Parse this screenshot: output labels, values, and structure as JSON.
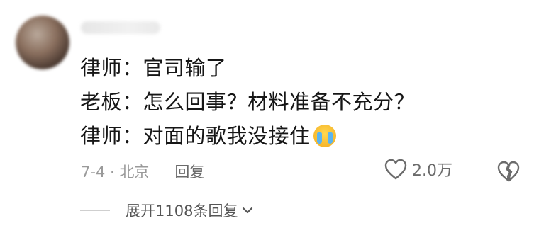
{
  "comment": {
    "lines": [
      "律师：官司输了",
      "老板：怎么回事？材料准备不充分？",
      "律师：对面的歌我没接住"
    ]
  },
  "meta": {
    "date_location": "7-4 · 北京",
    "reply_label": "回复"
  },
  "actions": {
    "like_count": "2.0万"
  },
  "replies": {
    "expand_label": "展开1108条回复"
  },
  "icons": {
    "like": "heart-outline-icon",
    "dislike": "broken-heart-icon",
    "emoji": "crying-face-emoji",
    "expand": "chevron-down-icon"
  }
}
